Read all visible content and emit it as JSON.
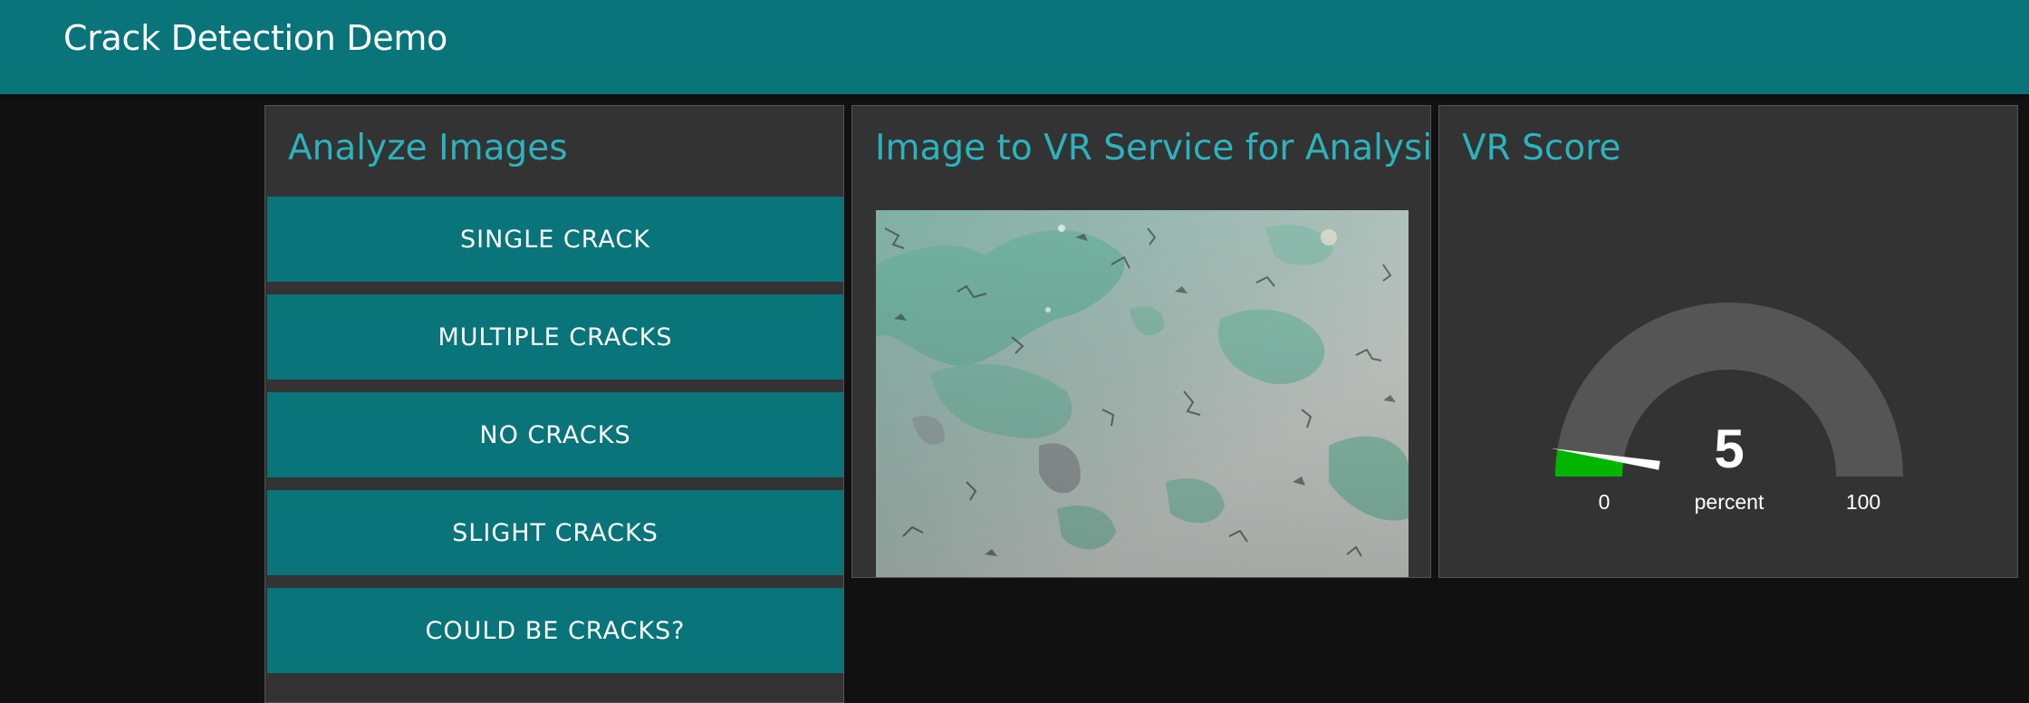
{
  "header": {
    "title": "Crack Detection Demo"
  },
  "analyze_panel": {
    "title": "Analyze Images",
    "buttons": [
      {
        "label": "SINGLE CRACK"
      },
      {
        "label": "MULTIPLE CRACKS"
      },
      {
        "label": "NO CRACKS"
      },
      {
        "label": "SLIGHT CRACKS"
      },
      {
        "label": "COULD BE CRACKS?"
      }
    ]
  },
  "image_panel": {
    "title": "Image to VR Service for Analysis",
    "image_description_icon": "peeling-paint-photo"
  },
  "score_panel": {
    "title": "VR Score",
    "gauge": {
      "value": "5",
      "value_number": 5,
      "units": "percent",
      "min": "0",
      "max": "100",
      "min_number": 0,
      "max_number": 100,
      "fill_color": "#00b500",
      "track_color": "#555555",
      "needle_color": "#ffffff"
    }
  },
  "colors": {
    "header_bg": "#097479",
    "panel_bg": "#333333",
    "title_color": "#2bb3bd",
    "button_bg": "#097479",
    "page_bg": "#111111"
  }
}
